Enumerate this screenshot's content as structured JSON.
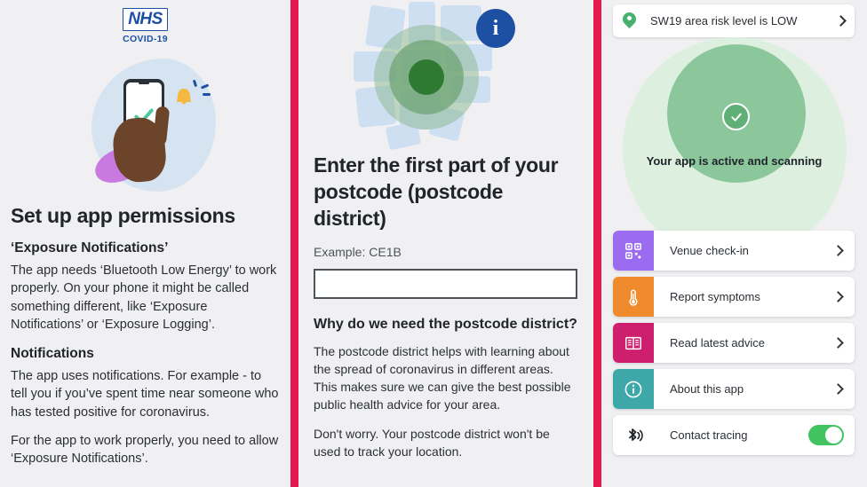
{
  "colors": {
    "divider_pink": "#e6164f",
    "panel_bg": "#f0f0f2",
    "nhs_blue": "#1d4fa3",
    "green_accent": "#46b06e",
    "toggle_on": "#42c362",
    "tile_purple": "#9b6bf0",
    "tile_orange": "#ef8b2c",
    "tile_magenta": "#cd1f6e",
    "tile_teal": "#3ea8a8"
  },
  "panel1": {
    "logo": {
      "mark": "NHS",
      "sub": "COVID-19",
      "icon": "nhs-logo-icon"
    },
    "illustration": "hand-holding-phone-with-bell-illustration",
    "title": "Set up app permissions",
    "sections": [
      {
        "heading": "‘Exposure Notifications’",
        "body": "The app needs ‘Bluetooth Low Energy’ to work properly. On your phone it might be called something different, like ‘Exposure Notifications’ or ‘Exposure Logging’."
      },
      {
        "heading": "Notifications",
        "body": "The app uses notifications. For example - to tell you if you’ve spent time near someone who has tested positive for coronavirus."
      }
    ],
    "closing": "For the app to work properly, you need to allow ‘Exposure Notifications’."
  },
  "panel2": {
    "illustration": "map-with-location-radius-illustration",
    "info_badge": "i",
    "title": "Enter the first part of your postcode (postcode district)",
    "example_label": "Example: CE1B",
    "input_value": "",
    "input_placeholder": "",
    "sub_heading": "Why do we need the postcode district?",
    "paragraphs": [
      "The postcode district helps with learning about the spread of coronavirus in different areas. This makes sure we can give the best possible public health advice for your area.",
      "Don't worry. Your postcode district won't be used to track your location."
    ]
  },
  "panel3": {
    "risk_card": {
      "label": "SW19 area risk level is LOW",
      "icon": "location-pin-icon",
      "chevron": "chevron-right-icon"
    },
    "status": {
      "text": "Your app is active and scanning",
      "icon": "check-circle-icon"
    },
    "menu": [
      {
        "label": "Venue check-in",
        "icon": "qr-code-icon",
        "tile_color": "#9b6bf0",
        "type": "link"
      },
      {
        "label": "Report symptoms",
        "icon": "thermometer-icon",
        "tile_color": "#ef8b2c",
        "type": "link"
      },
      {
        "label": "Read latest advice",
        "icon": "newspaper-icon",
        "tile_color": "#cd1f6e",
        "type": "link"
      },
      {
        "label": "About this app",
        "icon": "info-circle-icon",
        "tile_color": "#3ea8a8",
        "type": "link"
      },
      {
        "label": "Contact tracing",
        "icon": "bluetooth-icon",
        "tile_color": "",
        "type": "toggle",
        "toggle_on": true
      }
    ]
  }
}
